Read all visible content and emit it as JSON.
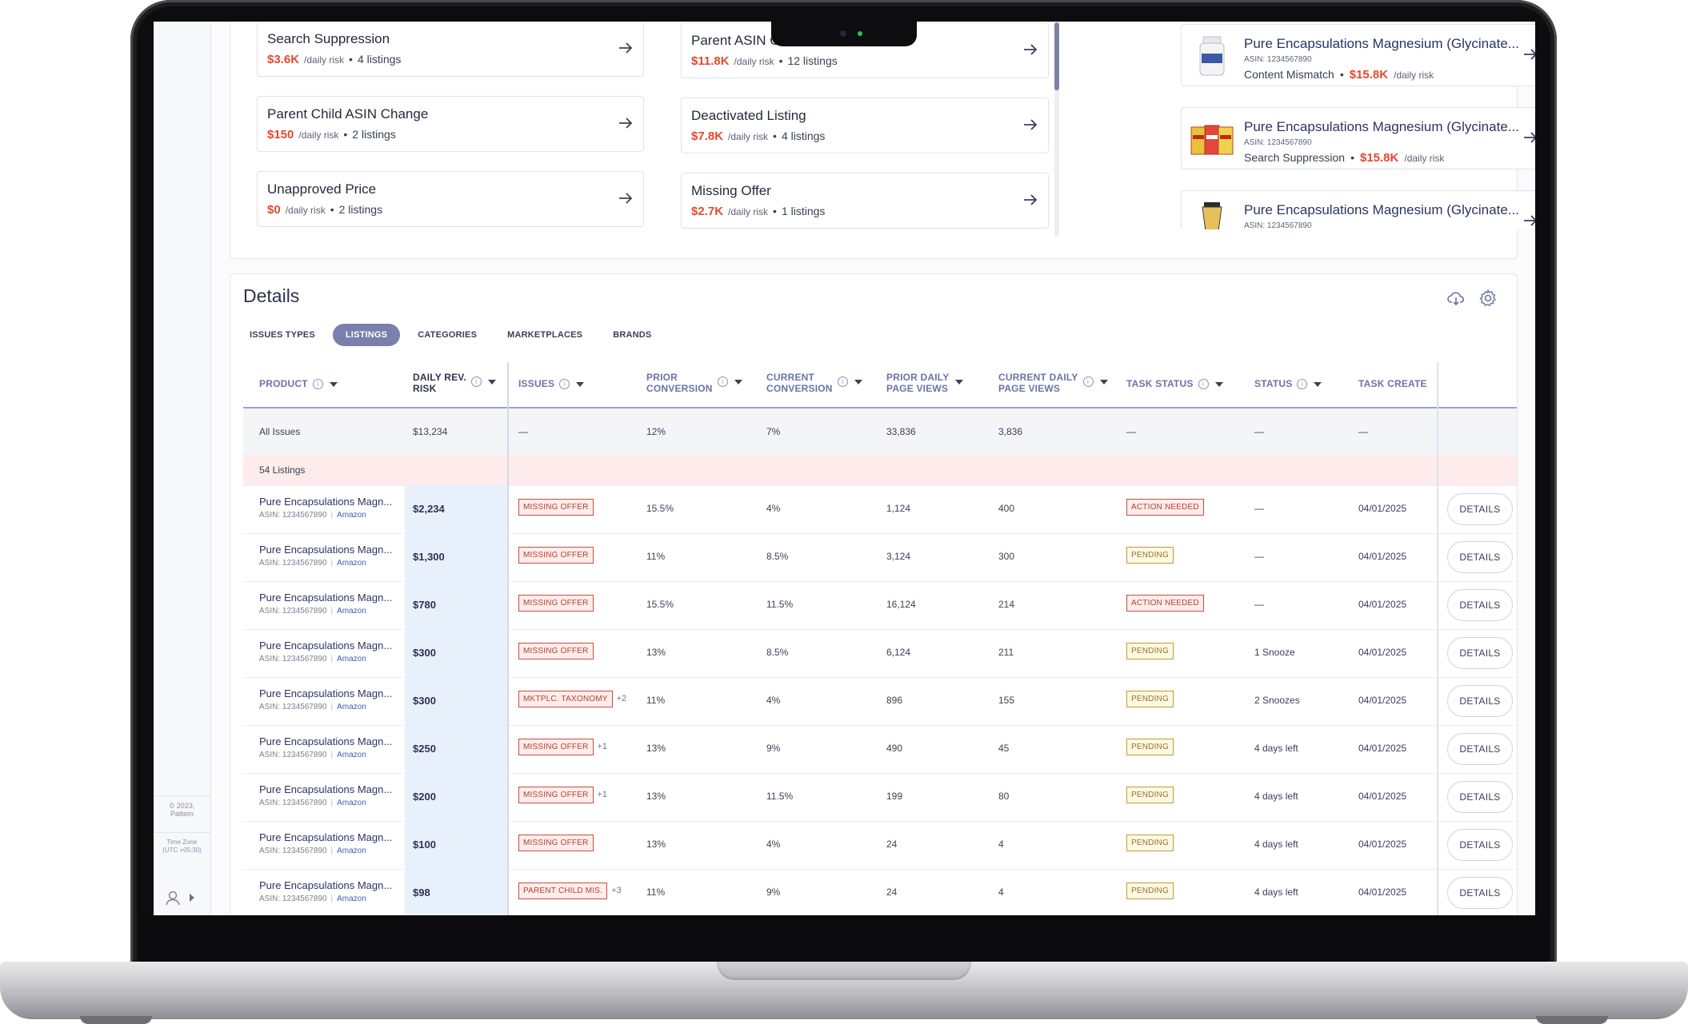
{
  "issue_cards_left": [
    {
      "title": "Search Suppression",
      "risk": "$3.6K",
      "unit": "/daily risk",
      "listings": "4 listings"
    },
    {
      "title": "Parent Child ASIN Change",
      "risk": "$150",
      "unit": "/daily risk",
      "listings": "2 listings"
    },
    {
      "title": "Unapproved Price",
      "risk": "$0",
      "unit": "/daily risk",
      "listings": "2 listings"
    }
  ],
  "issue_cards_mid": [
    {
      "title": "Parent ASIN C",
      "risk": "$11.8K",
      "unit": "/daily risk",
      "listings": "12 listings"
    },
    {
      "title": "Deactivated Listing",
      "risk": "$7.8K",
      "unit": "/daily risk",
      "listings": "4 listings"
    },
    {
      "title": "Missing Offer",
      "risk": "$2.7K",
      "unit": "/daily risk",
      "listings": "1 listings"
    }
  ],
  "product_cards": [
    {
      "title": "Pure Encapsulations Magnesium (Glycinate...",
      "asin": "ASIN: 1234567890",
      "issue": "Content Mismatch",
      "risk": "$15.8K",
      "unit": "/daily risk"
    },
    {
      "title": "Pure Encapsulations Magnesium (Glycinate...",
      "asin": "ASIN: 1234567890",
      "issue": "Search Suppression",
      "risk": "$15.8K",
      "unit": "/daily risk"
    },
    {
      "title": "Pure Encapsulations Magnesium (Glycinate...",
      "asin": "ASIN: 1234567890",
      "issue": "",
      "risk": "",
      "unit": ""
    }
  ],
  "sidebar": {
    "copyright": "© 2023,",
    "company": "Pattern",
    "tz_label": "Time Zone",
    "tz_value": "(UTC +05:30)"
  },
  "details": {
    "title": "Details",
    "tabs": [
      "ISSUES TYPES",
      "LISTINGS",
      "CATEGORIES",
      "MARKETPLACES",
      "BRANDS"
    ],
    "active_tab": "LISTINGS",
    "columns": {
      "product": "PRODUCT",
      "risk_1": "DAILY REV.",
      "risk_2": "RISK",
      "issues": "ISSUES",
      "prior_conv_1": "PRIOR",
      "prior_conv_2": "CONVERSION",
      "cur_conv_1": "CURRENT",
      "cur_conv_2": "CONVERSION",
      "prior_views_1": "PRIOR DAILY",
      "prior_views_2": "PAGE VIEWS",
      "cur_views_1": "CURRENT DAILY",
      "cur_views_2": "PAGE VIEWS",
      "task_status": "TASK STATUS",
      "status": "STATUS",
      "task_created": "TASK CREATE"
    },
    "summary": {
      "label": "All Issues",
      "risk": "$13,234",
      "issues": "—",
      "prior_conv": "12%",
      "cur_conv": "7%",
      "prior_views": "33,836",
      "cur_views": "3,836",
      "task_status": "—",
      "status": "—",
      "created": "—"
    },
    "group_label": "54 Listings",
    "rows": [
      {
        "name": "Pure Encapsulations Magn...",
        "asin": "ASIN: 1234567890",
        "market": "Amazon",
        "risk": "$2,234",
        "issue": "MISSING OFFER",
        "more": "",
        "prior_conv": "15.5%",
        "cur_conv": "4%",
        "prior_views": "1,124",
        "cur_views": "400",
        "task": "ACTION NEEDED",
        "status": "—",
        "date": "04/01/2025",
        "btn": "DETAILS"
      },
      {
        "name": "Pure Encapsulations Magn...",
        "asin": "ASIN: 1234567890",
        "market": "Amazon",
        "risk": "$1,300",
        "issue": "MISSING OFFER",
        "more": "",
        "prior_conv": "11%",
        "cur_conv": "8.5%",
        "prior_views": "3,124",
        "cur_views": "300",
        "task": "PENDING",
        "status": "—",
        "date": "04/01/2025",
        "btn": "DETAILS"
      },
      {
        "name": "Pure Encapsulations Magn...",
        "asin": "ASIN: 1234567890",
        "market": "Amazon",
        "risk": "$780",
        "issue": "MISSING OFFER",
        "more": "",
        "prior_conv": "15.5%",
        "cur_conv": "11.5%",
        "prior_views": "16,124",
        "cur_views": "214",
        "task": "ACTION NEEDED",
        "status": "—",
        "date": "04/01/2025",
        "btn": "DETAILS"
      },
      {
        "name": "Pure Encapsulations Magn...",
        "asin": "ASIN: 1234567890",
        "market": "Amazon",
        "risk": "$300",
        "issue": "MISSING OFFER",
        "more": "",
        "prior_conv": "13%",
        "cur_conv": "8.5%",
        "prior_views": "6,124",
        "cur_views": "211",
        "task": "PENDING",
        "status": "1 Snooze",
        "date": "04/01/2025",
        "btn": "DETAILS"
      },
      {
        "name": "Pure Encapsulations Magn...",
        "asin": "ASIN: 1234567890",
        "market": "Amazon",
        "risk": "$300",
        "issue": "MKTPLC. TAXONOMY",
        "more": "+2",
        "prior_conv": "11%",
        "cur_conv": "4%",
        "prior_views": "896",
        "cur_views": "155",
        "task": "PENDING",
        "status": "2 Snoozes",
        "date": "04/01/2025",
        "btn": "DETAILS"
      },
      {
        "name": "Pure Encapsulations Magn...",
        "asin": "ASIN: 1234567890",
        "market": "Amazon",
        "risk": "$250",
        "issue": "MISSING OFFER",
        "more": "+1",
        "prior_conv": "13%",
        "cur_conv": "9%",
        "prior_views": "490",
        "cur_views": "45",
        "task": "PENDING",
        "status": "4 days left",
        "date": "04/01/2025",
        "btn": "DETAILS"
      },
      {
        "name": "Pure Encapsulations Magn...",
        "asin": "ASIN: 1234567890",
        "market": "Amazon",
        "risk": "$200",
        "issue": "MISSING OFFER",
        "more": "+1",
        "prior_conv": "13%",
        "cur_conv": "11.5%",
        "prior_views": "199",
        "cur_views": "80",
        "task": "PENDING",
        "status": "4 days left",
        "date": "04/01/2025",
        "btn": "DETAILS"
      },
      {
        "name": "Pure Encapsulations Magn...",
        "asin": "ASIN: 1234567890",
        "market": "Amazon",
        "risk": "$100",
        "issue": "MISSING OFFER",
        "more": "",
        "prior_conv": "13%",
        "cur_conv": "4%",
        "prior_views": "24",
        "cur_views": "4",
        "task": "PENDING",
        "status": "4 days left",
        "date": "04/01/2025",
        "btn": "DETAILS"
      },
      {
        "name": "Pure Encapsulations Magn...",
        "asin": "ASIN: 1234567890",
        "market": "Amazon",
        "risk": "$98",
        "issue": "PARENT CHILD MIS.",
        "more": "+3",
        "prior_conv": "11%",
        "cur_conv": "9%",
        "prior_views": "24",
        "cur_views": "4",
        "task": "PENDING",
        "status": "4 days left",
        "date": "04/01/2025",
        "btn": "DETAILS"
      }
    ]
  },
  "colors": {
    "risk": "#e4492f",
    "accent": "#7980ac",
    "risk_column": "#e8f1fb",
    "group_row": "#fdeceb"
  },
  "icons": [
    "arrow-right-icon",
    "cloud-download-icon",
    "gear-icon",
    "info-icon",
    "sort-caret-icon",
    "user-icon",
    "chevron-right-icon"
  ]
}
